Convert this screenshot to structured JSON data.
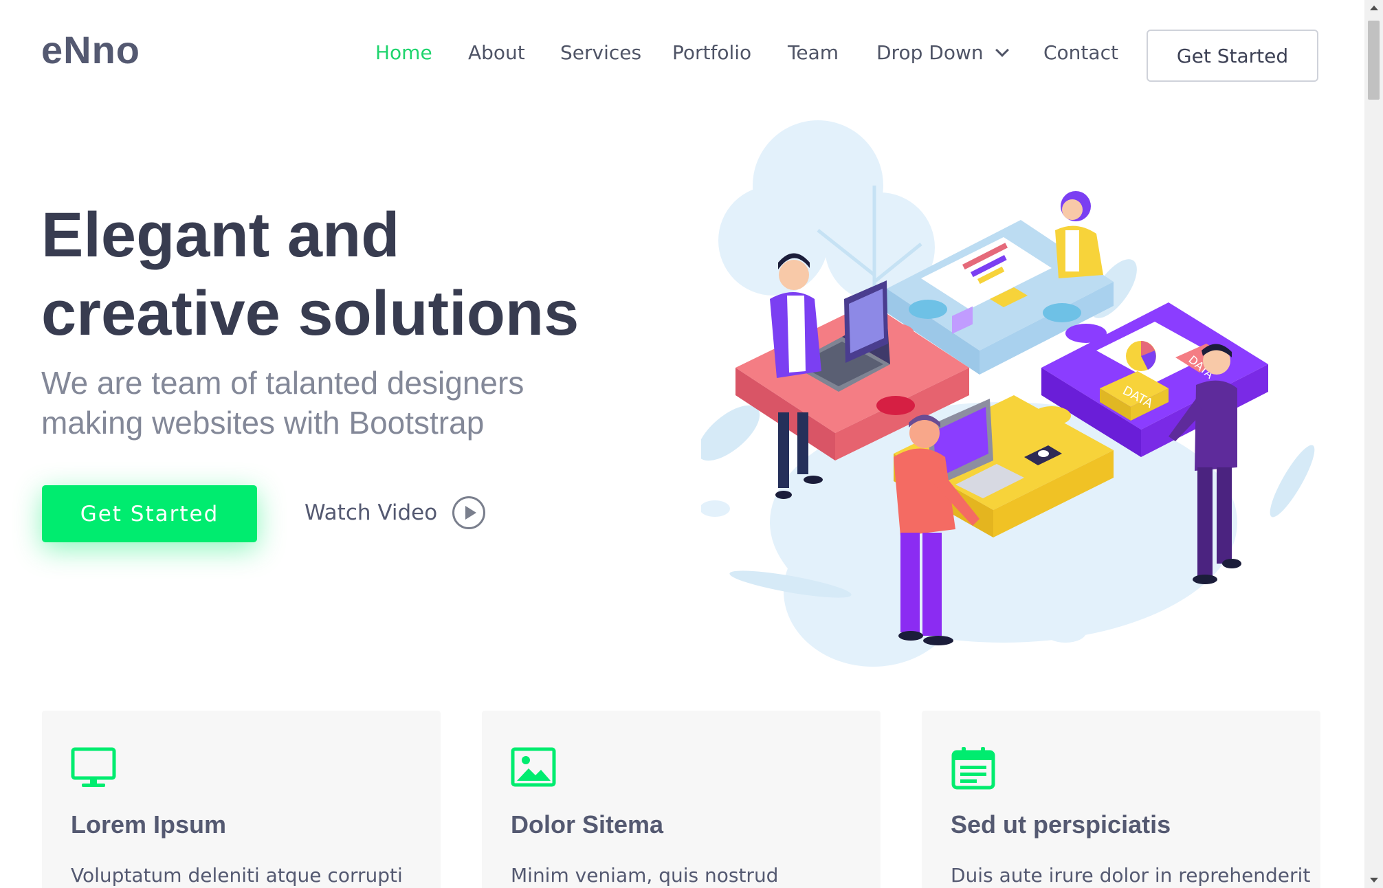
{
  "header": {
    "logo": "eNno",
    "nav": [
      {
        "label": "Home",
        "active": true
      },
      {
        "label": "About"
      },
      {
        "label": "Services"
      },
      {
        "label": "Portfolio"
      },
      {
        "label": "Team"
      },
      {
        "label": "Drop Down",
        "has_dropdown": true
      },
      {
        "label": "Contact"
      }
    ],
    "cta_label": "Get Started"
  },
  "hero": {
    "title_line1": "Elegant and",
    "title_line2": "creative solutions",
    "subtitle_line1": "We are team of talanted designers",
    "subtitle_line2": "making websites with Bootstrap",
    "primary_button": "Get Started",
    "watch_video": "Watch Video",
    "illustration_puzzle_labels": [
      "DATA",
      "DATA"
    ]
  },
  "cards": [
    {
      "icon": "monitor-icon",
      "title": "Lorem Ipsum",
      "text": "Voluptatum deleniti atque corrupti"
    },
    {
      "icon": "image-icon",
      "title": "Dolor Sitema",
      "text": "Minim veniam, quis nostrud"
    },
    {
      "icon": "calendar-list-icon",
      "title": "Sed ut perspiciatis",
      "text": "Duis aute irure dolor in reprehenderit"
    }
  ],
  "colors": {
    "accent": "#00ec6f",
    "active_nav": "#1ed46d",
    "heading": "#383c50",
    "muted": "#838898",
    "card_bg": "#f7f7f7"
  }
}
